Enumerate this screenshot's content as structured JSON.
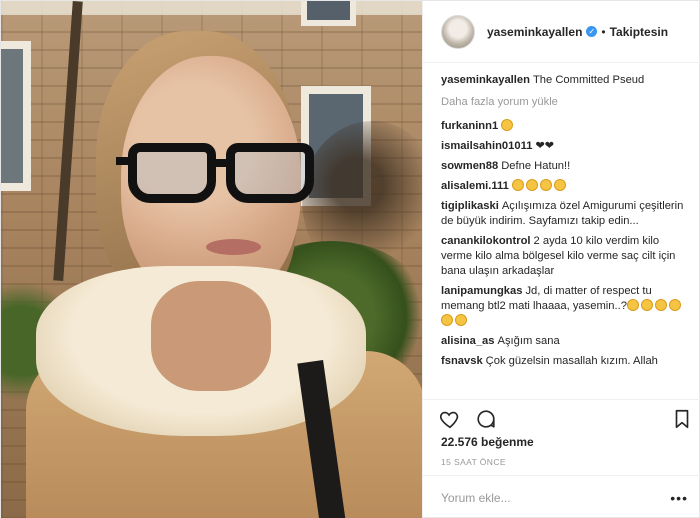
{
  "post": {
    "username": "yaseminkayallen",
    "follow_separator": "•",
    "follow_status": "Takiptesin",
    "caption": "The Committed Pseud",
    "load_more": "Daha fazla yorum yükle",
    "comments": [
      {
        "user": "furkaninn1",
        "text": "",
        "emojis": 1
      },
      {
        "user": "ismailsahin01011",
        "text": "❤❤",
        "emojis": 0
      },
      {
        "user": "sowmen88",
        "text": "Defne Hatun!!",
        "emojis": 0
      },
      {
        "user": "alisalemi.111",
        "text": "",
        "emojis": 4
      },
      {
        "user": "tigiplikaski",
        "text": "Açılışımıza özel Amigurumi çeşitlerin de büyük indirim. Sayfamızı takip edin...",
        "emojis": 0
      },
      {
        "user": "canankilokontrol",
        "text": "2 ayda 10 kilo verdim kilo verme kilo alma bölgesel kilo verme saç cilt için bana ulaşın arkadaşlar",
        "emojis": 0
      },
      {
        "user": "lanipamungkas",
        "text": "Jd, di matter of respect tu memang btl2 mati lhaaaa, yasemin..?",
        "emojis": 6
      },
      {
        "user": "alisina_as",
        "text": "Aşığım sana",
        "emojis": 0
      },
      {
        "user": "fsnavsk",
        "text": "Çok güzelsin masallah kızım. Allah",
        "emojis": 0
      }
    ],
    "likes": "22.576 beğenme",
    "time": "15 SAAT ÖNCE",
    "comment_placeholder": "Yorum ekle...",
    "more_options": "•••"
  },
  "colors": {
    "verified": "#3897f0",
    "muted": "#999999",
    "text": "#262626"
  },
  "icons": [
    "heart-icon",
    "comment-icon",
    "bookmark-icon",
    "verified-icon"
  ]
}
